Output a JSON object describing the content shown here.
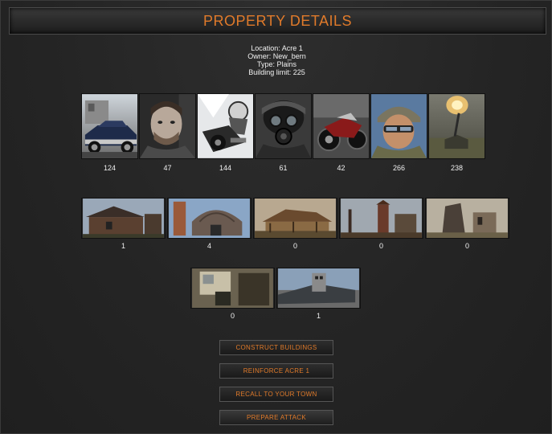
{
  "header": {
    "title": "PROPERTY DETAILS"
  },
  "info": {
    "location": "Location: Acre 1",
    "owner": "Owner: New_bern",
    "type": "Type: Plains",
    "building_limit": "Building limit: 225"
  },
  "units": [
    {
      "icon": "muscle-car-icon",
      "count": "124"
    },
    {
      "icon": "man-portrait-icon",
      "count": "47"
    },
    {
      "icon": "motorbike-rider-icon",
      "count": "144"
    },
    {
      "icon": "gas-mask-soldier-icon",
      "count": "61"
    },
    {
      "icon": "motorcycle-icon",
      "count": "42"
    },
    {
      "icon": "helmet-soldier-icon",
      "count": "266"
    },
    {
      "icon": "artillery-icon",
      "count": "238"
    }
  ],
  "buildings": [
    {
      "icon": "wooden-shack-icon",
      "count": "1"
    },
    {
      "icon": "barn-silo-icon",
      "count": "4"
    },
    {
      "icon": "lumber-mill-icon",
      "count": "0"
    },
    {
      "icon": "mine-tower-icon",
      "count": "0"
    },
    {
      "icon": "stone-ruin-icon",
      "count": "0"
    }
  ],
  "extra_buildings": [
    {
      "icon": "factory-interior-icon",
      "count": "0"
    },
    {
      "icon": "armored-train-icon",
      "count": "1"
    }
  ],
  "buttons": {
    "construct": "CONSTRUCT BUILDINGS",
    "reinforce": "REINFORCE ACRE 1",
    "recall": "RECALL TO YOUR TOWN",
    "attack": "PREPARE ATTACK"
  }
}
